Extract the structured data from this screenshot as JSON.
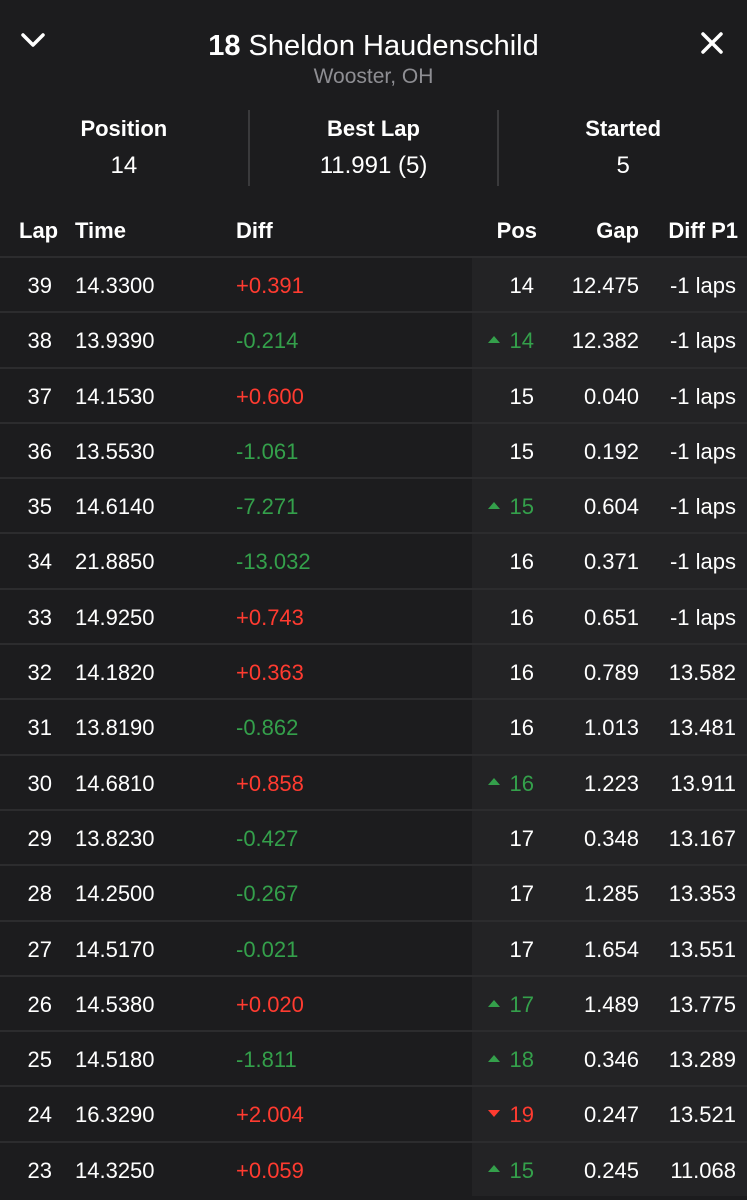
{
  "header": {
    "number": "18",
    "name": "Sheldon Haudenschild",
    "location": "Wooster, OH"
  },
  "stats": {
    "position_label": "Position",
    "position_value": "14",
    "best_lap_label": "Best Lap",
    "best_lap_value": "11.991 (5)",
    "started_label": "Started",
    "started_value": "5"
  },
  "columns": {
    "lap": "Lap",
    "time": "Time",
    "diff": "Diff",
    "pos": "Pos",
    "gap": "Gap",
    "diff_p1": "Diff P1"
  },
  "colors": {
    "positive": "#ff3b30",
    "negative": "#34a04b",
    "background": "#1c1c1e"
  },
  "rows": [
    {
      "lap": "39",
      "time": "14.3300",
      "diff": "+0.391",
      "diff_color": "red",
      "pos": "14",
      "pos_change": "none",
      "gap": "12.475",
      "diff_p1": "-1 laps"
    },
    {
      "lap": "38",
      "time": "13.9390",
      "diff": "-0.214",
      "diff_color": "green",
      "pos": "14",
      "pos_change": "up",
      "gap": "12.382",
      "diff_p1": "-1 laps"
    },
    {
      "lap": "37",
      "time": "14.1530",
      "diff": "+0.600",
      "diff_color": "red",
      "pos": "15",
      "pos_change": "none",
      "gap": "0.040",
      "diff_p1": "-1 laps"
    },
    {
      "lap": "36",
      "time": "13.5530",
      "diff": "-1.061",
      "diff_color": "green",
      "pos": "15",
      "pos_change": "none",
      "gap": "0.192",
      "diff_p1": "-1 laps"
    },
    {
      "lap": "35",
      "time": "14.6140",
      "diff": "-7.271",
      "diff_color": "green",
      "pos": "15",
      "pos_change": "up",
      "gap": "0.604",
      "diff_p1": "-1 laps"
    },
    {
      "lap": "34",
      "time": "21.8850",
      "diff": "-13.032",
      "diff_color": "green",
      "pos": "16",
      "pos_change": "none",
      "gap": "0.371",
      "diff_p1": "-1 laps"
    },
    {
      "lap": "33",
      "time": "14.9250",
      "diff": "+0.743",
      "diff_color": "red",
      "pos": "16",
      "pos_change": "none",
      "gap": "0.651",
      "diff_p1": "-1 laps"
    },
    {
      "lap": "32",
      "time": "14.1820",
      "diff": "+0.363",
      "diff_color": "red",
      "pos": "16",
      "pos_change": "none",
      "gap": "0.789",
      "diff_p1": "13.582"
    },
    {
      "lap": "31",
      "time": "13.8190",
      "diff": "-0.862",
      "diff_color": "green",
      "pos": "16",
      "pos_change": "none",
      "gap": "1.013",
      "diff_p1": "13.481"
    },
    {
      "lap": "30",
      "time": "14.6810",
      "diff": "+0.858",
      "diff_color": "red",
      "pos": "16",
      "pos_change": "up",
      "gap": "1.223",
      "diff_p1": "13.911"
    },
    {
      "lap": "29",
      "time": "13.8230",
      "diff": "-0.427",
      "diff_color": "green",
      "pos": "17",
      "pos_change": "none",
      "gap": "0.348",
      "diff_p1": "13.167"
    },
    {
      "lap": "28",
      "time": "14.2500",
      "diff": "-0.267",
      "diff_color": "green",
      "pos": "17",
      "pos_change": "none",
      "gap": "1.285",
      "diff_p1": "13.353"
    },
    {
      "lap": "27",
      "time": "14.5170",
      "diff": "-0.021",
      "diff_color": "green",
      "pos": "17",
      "pos_change": "none",
      "gap": "1.654",
      "diff_p1": "13.551"
    },
    {
      "lap": "26",
      "time": "14.5380",
      "diff": "+0.020",
      "diff_color": "red",
      "pos": "17",
      "pos_change": "up",
      "gap": "1.489",
      "diff_p1": "13.775"
    },
    {
      "lap": "25",
      "time": "14.5180",
      "diff": "-1.811",
      "diff_color": "green",
      "pos": "18",
      "pos_change": "up",
      "gap": "0.346",
      "diff_p1": "13.289"
    },
    {
      "lap": "24",
      "time": "16.3290",
      "diff": "+2.004",
      "diff_color": "red",
      "pos": "19",
      "pos_change": "down",
      "gap": "0.247",
      "diff_p1": "13.521"
    },
    {
      "lap": "23",
      "time": "14.3250",
      "diff": "+0.059",
      "diff_color": "red",
      "pos": "15",
      "pos_change": "up",
      "gap": "0.245",
      "diff_p1": "11.068"
    }
  ]
}
